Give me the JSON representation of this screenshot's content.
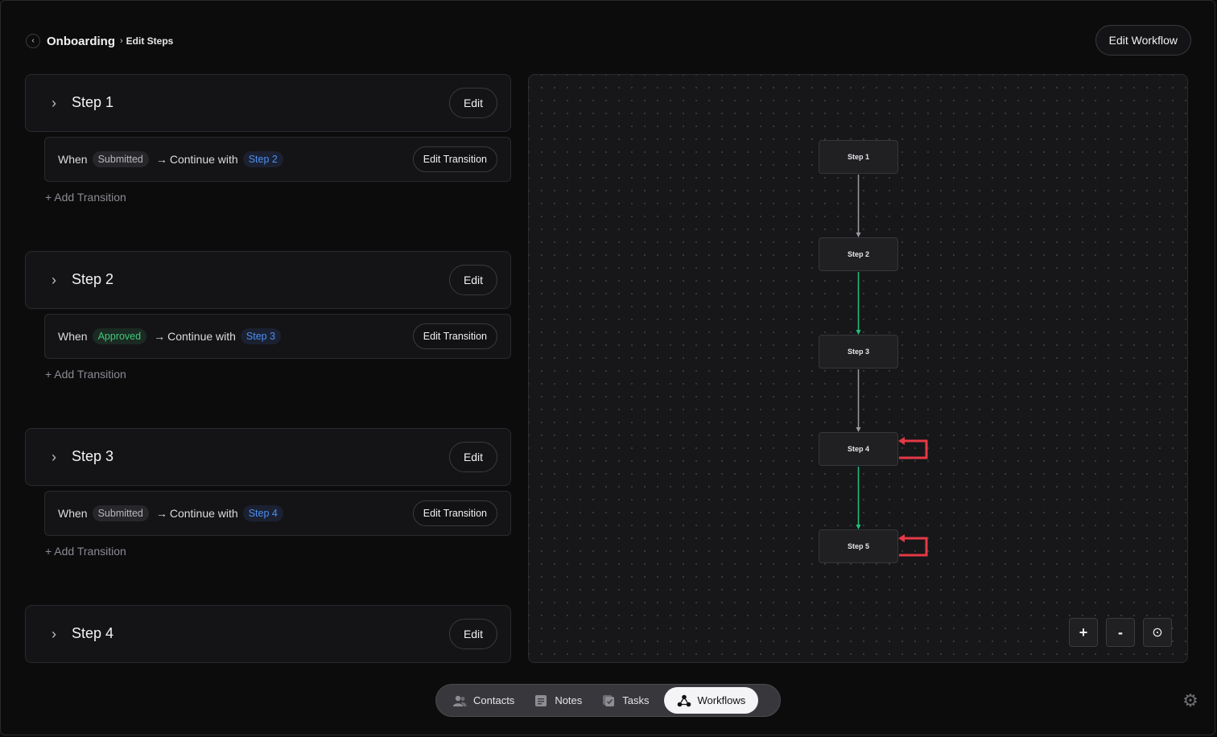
{
  "breadcrumb": {
    "title": "Onboarding",
    "separator": "›",
    "current": "Edit Steps"
  },
  "header": {
    "edit_workflow_label": "Edit Workflow"
  },
  "steps": [
    {
      "title": "Step 1",
      "edit_label": "Edit",
      "transition": {
        "when": "When",
        "condition": "Submitted",
        "condition_color": "grey",
        "continue_text": "Continue with",
        "target": "Step 2",
        "edit_label": "Edit Transition"
      },
      "add_transition": "+ Add Transition"
    },
    {
      "title": "Step 2",
      "edit_label": "Edit",
      "transition": {
        "when": "When",
        "condition": "Approved",
        "condition_color": "green",
        "continue_text": "Continue with",
        "target": "Step 3",
        "edit_label": "Edit Transition"
      },
      "add_transition": "+ Add Transition"
    },
    {
      "title": "Step 3",
      "edit_label": "Edit",
      "transition": {
        "when": "When",
        "condition": "Submitted",
        "condition_color": "grey",
        "continue_text": "Continue with",
        "target": "Step 4",
        "edit_label": "Edit Transition"
      },
      "add_transition": "+ Add Transition"
    },
    {
      "title": "Step 4",
      "edit_label": "Edit"
    }
  ],
  "graph": {
    "nodes": [
      "Step 1",
      "Step 2",
      "Step 3",
      "Step 4",
      "Step 5"
    ],
    "edges": [
      {
        "from": "Step 1",
        "to": "Step 2",
        "color": "#9a9aa0"
      },
      {
        "from": "Step 2",
        "to": "Step 3",
        "color": "#22c17a"
      },
      {
        "from": "Step 3",
        "to": "Step 4",
        "color": "#9a9aa0"
      },
      {
        "from": "Step 4",
        "to": "Step 5",
        "color": "#22c17a"
      },
      {
        "from": "Step 4",
        "to": "Step 4",
        "color": "#e53a45"
      },
      {
        "from": "Step 5",
        "to": "Step 5",
        "color": "#e53a45"
      }
    ],
    "controls": {
      "zoom_in": "+",
      "zoom_out": "-",
      "fit": "⊙"
    }
  },
  "nav": {
    "items": [
      {
        "label": "Contacts",
        "icon": "contacts-icon",
        "active": false
      },
      {
        "label": "Notes",
        "icon": "notes-icon",
        "active": false
      },
      {
        "label": "Tasks",
        "icon": "tasks-icon",
        "active": false
      },
      {
        "label": "Workflows",
        "icon": "workflows-icon",
        "active": true
      }
    ]
  },
  "colors": {
    "accent_green": "#22c17a",
    "accent_red": "#e53a45",
    "accent_blue": "#4d8ff0"
  }
}
